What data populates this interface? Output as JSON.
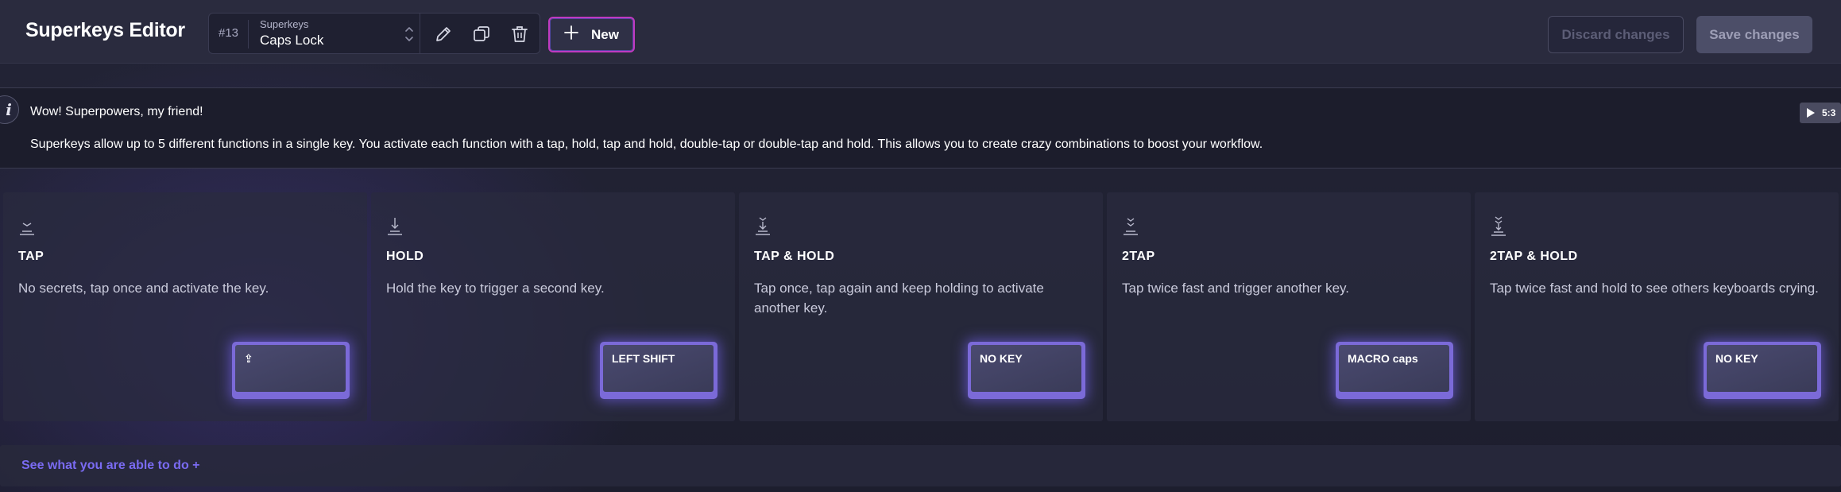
{
  "header": {
    "title": "Superkeys Editor",
    "selector": {
      "number": "#13",
      "label": "Superkeys",
      "value": "Caps Lock"
    },
    "new_label": "New",
    "discard_label": "Discard changes",
    "save_label": "Save changes",
    "icons": [
      "chevron-updown-icon",
      "pencil-icon",
      "copy-icon",
      "trash-icon",
      "plus-icon"
    ]
  },
  "banner": {
    "title": "Wow! Superpowers, my friend!",
    "text": "Superkeys allow up to 5 different functions in a single key. You activate each function with a tap, hold, tap and hold, double-tap or double-tap and hold. This allows you to create crazy combinations to boost your workflow.",
    "video_time": "5:3",
    "info_glyph": "i"
  },
  "cards": [
    {
      "icon": "tap-icon",
      "title": "TAP",
      "description": "No secrets, tap once and activate the key.",
      "key": "⇪"
    },
    {
      "icon": "hold-icon",
      "title": "HOLD",
      "description": "Hold the key to trigger a second key.",
      "key": "LEFT SHIFT"
    },
    {
      "icon": "tap-hold-icon",
      "title": "TAP & HOLD",
      "description": "Tap once, tap again and keep holding to activate another key.",
      "key": "NO KEY"
    },
    {
      "icon": "double-tap-icon",
      "title": "2TAP",
      "description": "Tap twice fast and trigger another key.",
      "key": "MACRO caps"
    },
    {
      "icon": "double-tap-hold-icon",
      "title": "2TAP & HOLD",
      "description": "Tap twice fast and hold to see others keyboards crying.",
      "key": "NO KEY"
    }
  ],
  "footer": {
    "link": "See what you are able to do  +"
  },
  "colors": {
    "accent": "#7a6bf2",
    "new_button_border": "#c03ac0",
    "key_glow": "#7b67ff"
  }
}
